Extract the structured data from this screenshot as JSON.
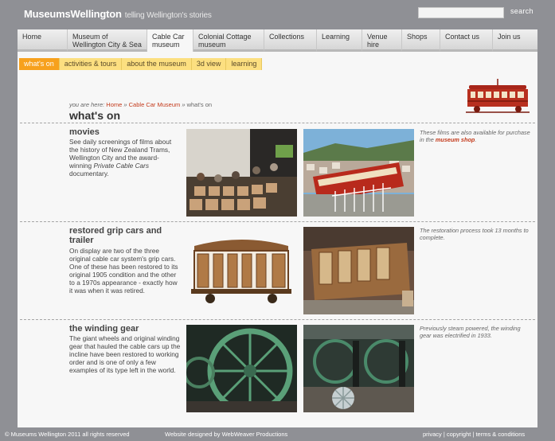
{
  "header": {
    "logo": "MuseumsWellington",
    "tagline": "telling Wellington's stories",
    "search_placeholder": "",
    "search_label": "search"
  },
  "nav": [
    {
      "label": "Home"
    },
    {
      "label": "Museum of Wellington City & Sea"
    },
    {
      "label": "Cable Car museum"
    },
    {
      "label": "Colonial Cottage museum"
    },
    {
      "label": "Collections"
    },
    {
      "label": "Learning"
    },
    {
      "label": "Venue hire"
    },
    {
      "label": "Shops"
    },
    {
      "label": "Contact us"
    },
    {
      "label": "Join us"
    }
  ],
  "subnav": [
    {
      "label": "what's on"
    },
    {
      "label": "activities & tours"
    },
    {
      "label": "about the museum"
    },
    {
      "label": "3d view"
    },
    {
      "label": "learning"
    }
  ],
  "breadcrumb": {
    "prefix": "you are here: ",
    "home": "Home",
    "sep1": " » ",
    "museum": "Cable Car Museum",
    "sep2": " » ",
    "current": "what's on"
  },
  "page_title": "what's on",
  "sections": {
    "movies": {
      "title": "movies",
      "body1": "See daily screenings of films about the history of New Zealand Trams, Wellington City and the award-winning ",
      "body_em": "Private Cable Cars",
      "body2": " documentary.",
      "note1": "These films are also available for purchase in the ",
      "note_link": "museum shop",
      "note2": "."
    },
    "grip": {
      "title": "restored grip cars and trailer",
      "body": "On display are two of the three original cable car system's grip cars. One of these has been restored to its original 1905 condition and the other to a 1970s appearance - exactly how it was when it was retired.",
      "note": "The restoration process took 13 months to complete."
    },
    "gear": {
      "title": "the winding gear",
      "body": "The giant wheels and original winding gear that hauled the cable cars up the incline have been restored to working order and is one of only a few examples of its type left in the world.",
      "note": "Previously steam powered, the winding gear was electrified in 1933."
    }
  },
  "footer": {
    "copyright": "© Museums Wellington 2011 all rights reserved",
    "designed": "Website designed by WebWeaver Productions",
    "privacy": "privacy",
    "copyright_link": "copyright",
    "terms": "terms & conditions",
    "sep": " | "
  }
}
